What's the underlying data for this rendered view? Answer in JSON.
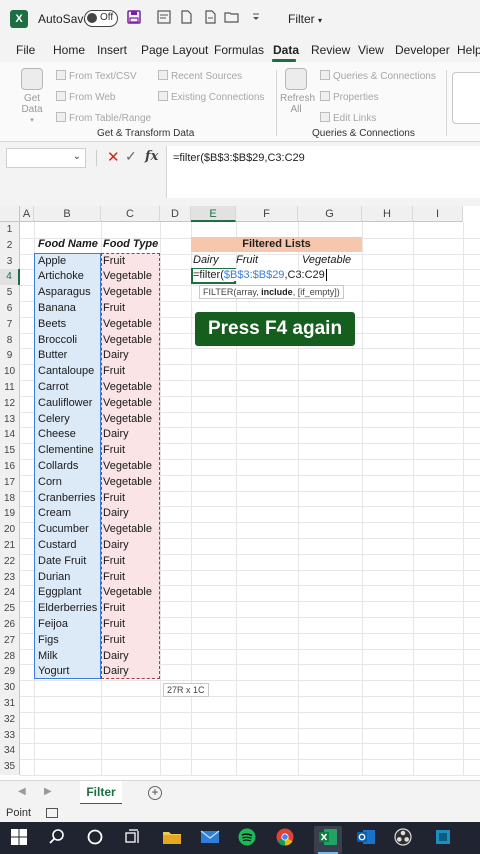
{
  "titlebar": {
    "app_icon_label": "X",
    "autosave_label": "AutoSave",
    "autosave_state": "Off",
    "doc_title": "Filter",
    "qat_icons": [
      "save-icon",
      "form-icon",
      "new-icon",
      "print-icon",
      "open-icon",
      "more-icon"
    ]
  },
  "ribbon_tabs": [
    "File",
    "Home",
    "Insert",
    "Page Layout",
    "Formulas",
    "Data",
    "Review",
    "View",
    "Developer",
    "Help"
  ],
  "ribbon": {
    "get_data_label": "Get Data",
    "from_text_csv": "From Text/CSV",
    "from_web": "From Web",
    "from_table_range": "From Table/Range",
    "recent_sources": "Recent Sources",
    "existing_connections": "Existing Connections",
    "group_get_transform": "Get & Transform Data",
    "refresh_all_label": "Refresh All",
    "queries_connections": "Queries & Connections",
    "properties": "Properties",
    "edit_links": "Edit Links",
    "group_queries": "Queries & Connections"
  },
  "formula_bar": {
    "name_box_value": "",
    "formula": "=filter($B$3:$B$29,C3:C29"
  },
  "grid": {
    "columns": [
      "A",
      "B",
      "C",
      "D",
      "E",
      "F",
      "G",
      "H",
      "I"
    ],
    "rows": [
      "1",
      "2",
      "3",
      "4",
      "5",
      "6",
      "7",
      "8",
      "9",
      "10",
      "11",
      "12",
      "13",
      "14",
      "15",
      "16",
      "17",
      "18",
      "19",
      "20",
      "21",
      "22",
      "23",
      "24",
      "25",
      "26",
      "27",
      "28",
      "29",
      "30",
      "31",
      "32",
      "33",
      "34",
      "35"
    ],
    "header_food_name": "Food Name",
    "header_food_type": "Food Type",
    "food_names": [
      "Apple",
      "Artichoke",
      "Asparagus",
      "Banana",
      "Beets",
      "Broccoli",
      "Butter",
      "Cantaloupe",
      "Carrot",
      "Cauliflower",
      "Celery",
      "Cheese",
      "Clementine",
      "Collards",
      "Corn",
      "Cranberries",
      "Cream",
      "Cucumber",
      "Custard",
      "Date Fruit",
      "Durian",
      "Eggplant",
      "Elderberries",
      "Feijoa",
      "Figs",
      "Milk",
      "Yogurt"
    ],
    "food_types": [
      "Fruit",
      "Vegetable",
      "Vegetable",
      "Fruit",
      "Vegetable",
      "Vegetable",
      "Dairy",
      "Fruit",
      "Vegetable",
      "Vegetable",
      "Vegetable",
      "Dairy",
      "Fruit",
      "Vegetable",
      "Vegetable",
      "Fruit",
      "Dairy",
      "Vegetable",
      "Dairy",
      "Fruit",
      "Fruit",
      "Vegetable",
      "Fruit",
      "Fruit",
      "Fruit",
      "Dairy",
      "Dairy"
    ],
    "filtered_header": "Filtered Lists",
    "filtered_cols": [
      "Dairy",
      "Fruit",
      "Vegetable"
    ],
    "edit_prefix": "=filter(",
    "edit_ref_b": "$B$3:$B$29",
    "edit_sep": ",",
    "edit_ref_c": "C3:C29",
    "tooltip_prefix": "FILTER(array, ",
    "tooltip_bold": "include",
    "tooltip_suffix": ", [if_empty])",
    "banner": "Press F4 again",
    "size_indicator": "27R x 1C"
  },
  "sheet": {
    "tab_name": "Filter",
    "add_label": "+"
  },
  "status": {
    "mode": "Point"
  },
  "taskbar": {
    "icons": [
      "windows-icon",
      "search-icon",
      "cortana-icon",
      "task-view-icon",
      "file-explorer-icon",
      "mail-icon",
      "spotify-icon",
      "chrome-icon",
      "excel-icon",
      "outlook-icon",
      "obs-icon",
      "app-icon"
    ]
  }
}
